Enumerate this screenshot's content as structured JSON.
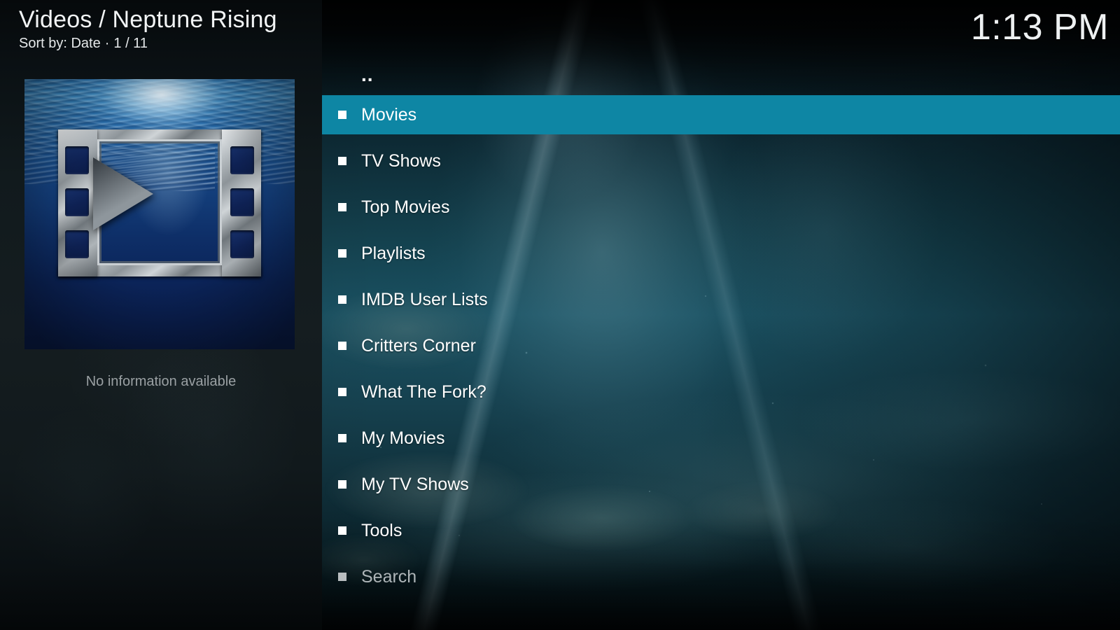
{
  "header": {
    "breadcrumb": "Videos /  Neptune Rising",
    "sort_prefix": "Sort by: Date",
    "separator": "·",
    "page_indicator": "1 / 11"
  },
  "clock": {
    "time": "1:13 PM"
  },
  "info_panel": {
    "poster_alt": "video-file-placeholder-underwater-filmstrip",
    "no_info_text": "No information available"
  },
  "menu": {
    "parent_entry": "..",
    "selected_index": 0,
    "highlight_color": "#0e86a4",
    "items": [
      {
        "label": "Movies",
        "state": "selected"
      },
      {
        "label": "TV Shows",
        "state": "normal"
      },
      {
        "label": "Top Movies",
        "state": "normal"
      },
      {
        "label": "Playlists",
        "state": "normal"
      },
      {
        "label": "IMDB User Lists",
        "state": "normal"
      },
      {
        "label": "Critters Corner",
        "state": "normal"
      },
      {
        "label": "What The Fork?",
        "state": "normal"
      },
      {
        "label": "My Movies",
        "state": "normal"
      },
      {
        "label": "My TV Shows",
        "state": "normal"
      },
      {
        "label": "Tools",
        "state": "normal"
      },
      {
        "label": "Search",
        "state": "dim"
      }
    ]
  }
}
